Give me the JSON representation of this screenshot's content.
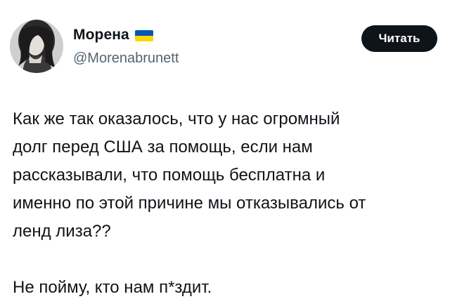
{
  "author": {
    "display_name": "Морена",
    "handle": "@Morenabrunett",
    "flag": "ukraine-flag",
    "flag_colors": [
      "#0057b7",
      "#ffd700"
    ]
  },
  "actions": {
    "follow_label": "Читать"
  },
  "tweet": {
    "paragraph_1": "Как же так оказалось, что у нас огромный\nдолг перед США за помощь, если нам\nрассказывали, что помощь бесплатна и\nименно по этой причине мы отказывались от\nленд лиза??",
    "paragraph_2": "Не пойму, кто нам п*здит."
  },
  "colors": {
    "text": "#0f1419",
    "secondary": "#536471",
    "button_bg": "#0f1419",
    "button_text": "#ffffff"
  }
}
